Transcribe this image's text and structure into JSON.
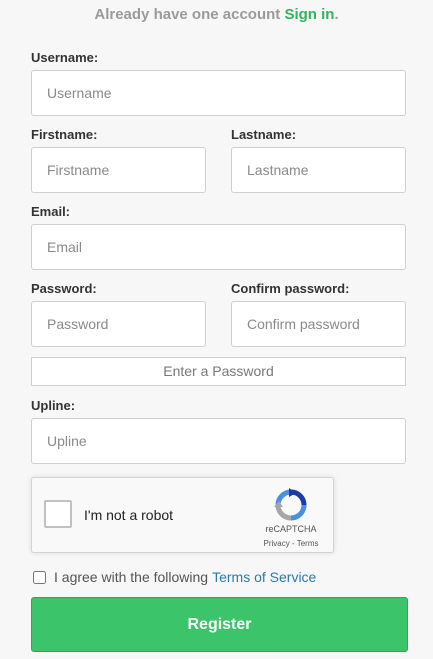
{
  "header": {
    "prompt": "Already have one account",
    "signin_label": "Sign in",
    "period": "."
  },
  "form": {
    "username": {
      "label": "Username:",
      "placeholder": "Username",
      "value": ""
    },
    "firstname": {
      "label": "Firstname:",
      "placeholder": "Firstname",
      "value": ""
    },
    "lastname": {
      "label": "Lastname:",
      "placeholder": "Lastname",
      "value": ""
    },
    "email": {
      "label": "Email:",
      "placeholder": "Email",
      "value": ""
    },
    "password": {
      "label": "Password:",
      "placeholder": "Password",
      "value": ""
    },
    "confirm_password": {
      "label": "Confirm password:",
      "placeholder": "Confirm password",
      "value": ""
    },
    "password_strength": "Enter a Password",
    "upline": {
      "label": "Upline:",
      "placeholder": "Upline",
      "value": ""
    }
  },
  "captcha": {
    "label": "I'm not a robot",
    "brand": "reCAPTCHA",
    "links": "Privacy - Terms",
    "checked": false
  },
  "agreement": {
    "text": "I agree with the following",
    "link": "Terms of Service",
    "checked": false
  },
  "submit_label": "Register",
  "colors": {
    "accent_green": "#3bc46a",
    "link_blue": "#2a7ab0",
    "signin_green": "#2fb55c"
  }
}
